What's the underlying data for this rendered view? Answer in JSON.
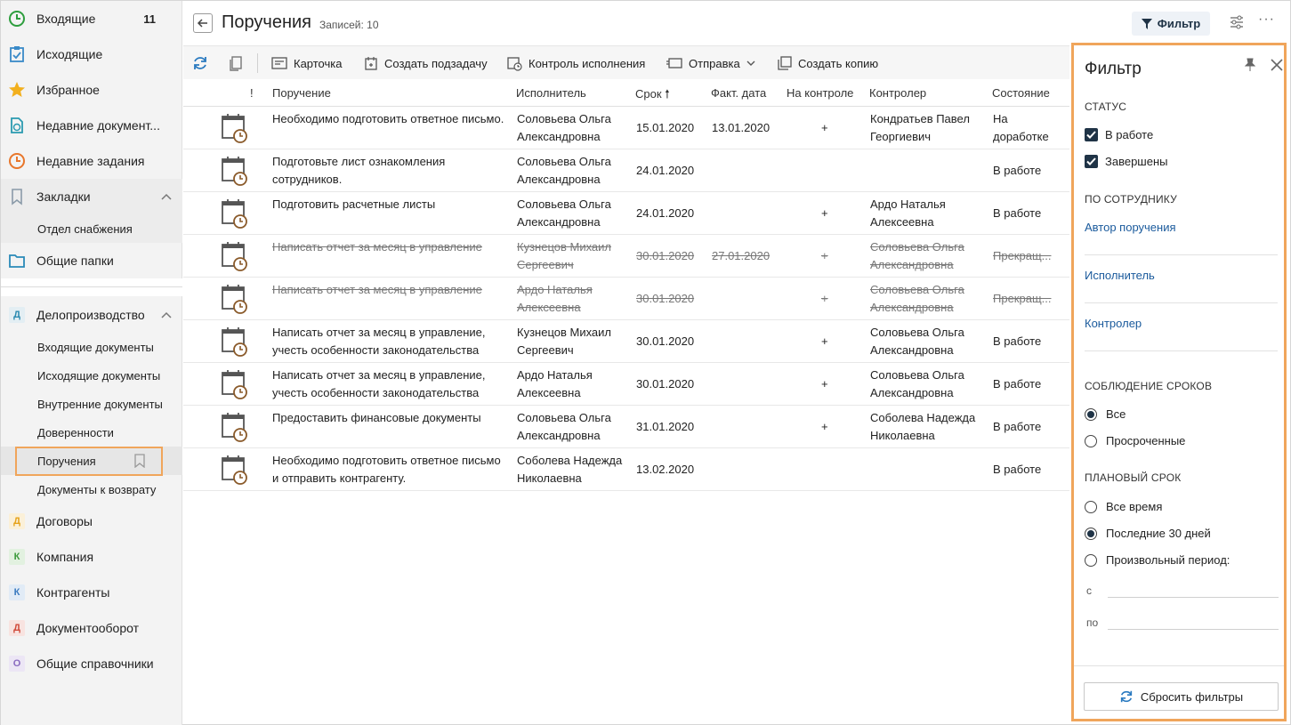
{
  "sidebar": {
    "items": [
      {
        "label": "Входящие",
        "count": "11",
        "icon": "clock-green-icon"
      },
      {
        "label": "Исходящие",
        "icon": "clipboard-check-icon"
      },
      {
        "label": "Избранное",
        "icon": "star-icon"
      },
      {
        "label": "Недавние документ...",
        "icon": "recent-document-icon"
      },
      {
        "label": "Недавние задания",
        "icon": "recent-task-icon"
      },
      {
        "label": "Закладки",
        "icon": "bookmark-icon"
      },
      {
        "label": "Общие папки",
        "icon": "folder-icon"
      },
      {
        "label": "Делопроизводство",
        "icon": "letter-d-icon",
        "letter": "Д"
      },
      {
        "label": "Договоры",
        "letter": "Д"
      },
      {
        "label": "Компания",
        "letter": "К"
      },
      {
        "label": "Контрагенты",
        "letter": "К"
      },
      {
        "label": "Документооборот",
        "letter": "Д"
      },
      {
        "label": "Общие справочники",
        "letter": "О"
      }
    ],
    "bookmarks_sub": [
      "Отдел снабжения"
    ],
    "records_sub": [
      "Входящие документы",
      "Исходящие документы",
      "Внутренние документы",
      "Доверенности",
      "Поручения",
      "Документы к возврату"
    ]
  },
  "header": {
    "title": "Поручения",
    "records": "Записей: 10",
    "filter_label": "Фильтр"
  },
  "toolbar": {
    "card": "Карточка",
    "subtask": "Создать подзадачу",
    "control": "Контроль исполнения",
    "send": "Отправка",
    "copy": "Создать копию"
  },
  "table": {
    "columns": [
      "!",
      "Поручение",
      "Исполнитель",
      "Срок",
      "Факт. дата",
      "На контроле",
      "Контролер",
      "Состояние"
    ],
    "rows": [
      {
        "task": "Необходимо подготовить ответное письмо.",
        "executor": "Соловьева Ольга Александровна",
        "due": "15.01.2020",
        "fact": "13.01.2020",
        "control": "+",
        "controller": "Кондратьев Павел Георгиевич",
        "state": "На доработке",
        "struck": false
      },
      {
        "task": "Подготовьте лист ознакомления сотрудников.",
        "executor": "Соловьева Ольга Александровна",
        "due": "24.01.2020",
        "fact": "",
        "control": "",
        "controller": "",
        "state": "В работе",
        "struck": false
      },
      {
        "task": "Подготовить расчетные листы",
        "executor": "Соловьева Ольга Александровна",
        "due": "24.01.2020",
        "fact": "",
        "control": "+",
        "controller": "Ардо Наталья Алексеевна",
        "state": "В работе",
        "struck": false
      },
      {
        "task": "Написать отчет за месяц в управление",
        "executor": "Кузнецов Михаил Сергеевич",
        "due": "30.01.2020",
        "fact": "27.01.2020",
        "control": "+",
        "controller": "Соловьева Ольга Александровна",
        "state": "Прекращ...",
        "struck": true
      },
      {
        "task": "Написать отчет за месяц в управление",
        "executor": "Ардо Наталья Алексеевна",
        "due": "30.01.2020",
        "fact": "",
        "control": "+",
        "controller": "Соловьева Ольга Александровна",
        "state": "Прекращ...",
        "struck": true
      },
      {
        "task": "Написать отчет за месяц в управление, учесть особенности законодательства",
        "executor": "Кузнецов Михаил Сергеевич",
        "due": "30.01.2020",
        "fact": "",
        "control": "+",
        "controller": "Соловьева Ольга Александровна",
        "state": "В работе",
        "struck": false
      },
      {
        "task": "Написать отчет за месяц в управление, учесть особенности законодательства",
        "executor": "Ардо Наталья Алексеевна",
        "due": "30.01.2020",
        "fact": "",
        "control": "+",
        "controller": "Соловьева Ольга Александровна",
        "state": "В работе",
        "struck": false
      },
      {
        "task": "Предоставить финансовые документы",
        "executor": "Соловьева Ольга Александровна",
        "due": "31.01.2020",
        "fact": "",
        "control": "+",
        "controller": "Соболева Надежда Николаевна",
        "state": "В работе",
        "struck": false
      },
      {
        "task": "Необходимо подготовить ответное письмо и отправить контрагенту.",
        "executor": "Соболева Надежда Николаевна",
        "due": "13.02.2020",
        "fact": "",
        "control": "",
        "controller": "",
        "state": "В работе",
        "struck": false
      }
    ]
  },
  "filter": {
    "title": "Фильтр",
    "status_section": "СТАТУС",
    "status_in_work": "В работе",
    "status_done": "Завершены",
    "employee_section": "ПО СОТРУДНИКУ",
    "author_link": "Автор поручения",
    "executor_link": "Исполнитель",
    "controller_link": "Контролер",
    "deadline_section": "СОБЛЮДЕНИЕ СРОКОВ",
    "deadline_all": "Все",
    "deadline_overdue": "Просроченные",
    "planned_section": "ПЛАНОВЫЙ СРОК",
    "planned_all": "Все время",
    "planned_30": "Последние 30 дней",
    "planned_custom": "Произвольный период:",
    "from_label": "с",
    "to_label": "по",
    "reset": "Сбросить фильтры"
  }
}
